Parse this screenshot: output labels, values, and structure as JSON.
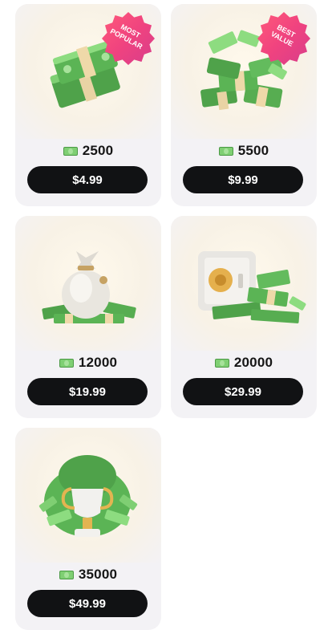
{
  "packs": [
    {
      "amount": "2500",
      "price": "$4.99",
      "badge": "MOST POPULAR",
      "badge_lines": [
        "MOST",
        "POPULAR"
      ],
      "art": "stack-of-cash"
    },
    {
      "amount": "5500",
      "price": "$9.99",
      "badge": "BEST VALUE",
      "badge_lines": [
        "BEST",
        "VALUE"
      ],
      "art": "pile-of-cash-bundles"
    },
    {
      "amount": "12000",
      "price": "$19.99",
      "art": "money-bag"
    },
    {
      "amount": "20000",
      "price": "$29.99",
      "art": "safe-with-cash"
    },
    {
      "amount": "35000",
      "price": "$49.99",
      "art": "trophy-with-cash"
    }
  ],
  "icons": {
    "currency": "cash-icon"
  },
  "colors": {
    "badge_gradient_start": "#ff5a7a",
    "badge_gradient_end": "#d73d8b",
    "button_bg": "#111214",
    "card_bg": "#f3f2f5",
    "cash_green": "#7fcf73"
  }
}
